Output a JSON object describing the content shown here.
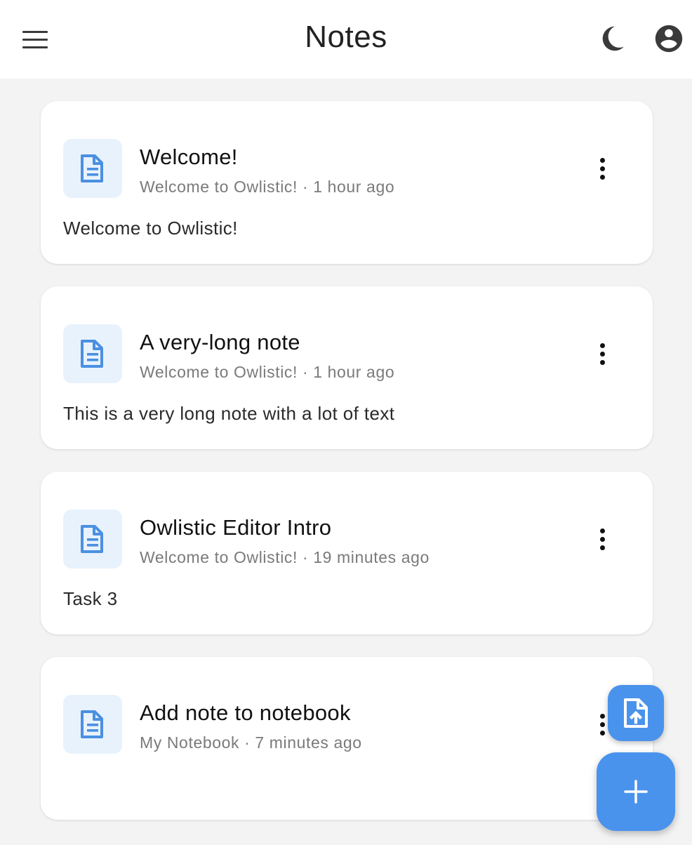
{
  "app": {
    "title": "Notes"
  },
  "colors": {
    "accent": "#4a93ec",
    "icon_bg": "#e8f2fd",
    "background": "#f3f3f3"
  },
  "header": {
    "menu_icon": "hamburger-menu-icon",
    "theme_icon": "dark-mode-moon-icon",
    "account_icon": "account-circle-icon"
  },
  "notes": [
    {
      "title": "Welcome!",
      "meta": "Welcome to Owlistic! · 1 hour ago",
      "preview": "Welcome to Owlistic!"
    },
    {
      "title": "A very-long note",
      "meta": "Welcome to Owlistic! · 1 hour ago",
      "preview": "This is a very long note with a lot of text"
    },
    {
      "title": "Owlistic Editor Intro",
      "meta": "Welcome to Owlistic! · 19 minutes ago",
      "preview": "Task 3"
    },
    {
      "title": "Add note to notebook",
      "meta": "My Notebook · 7 minutes ago",
      "preview": ""
    }
  ],
  "fabs": {
    "import_icon": "file-upload-icon",
    "add_icon": "plus-icon"
  }
}
